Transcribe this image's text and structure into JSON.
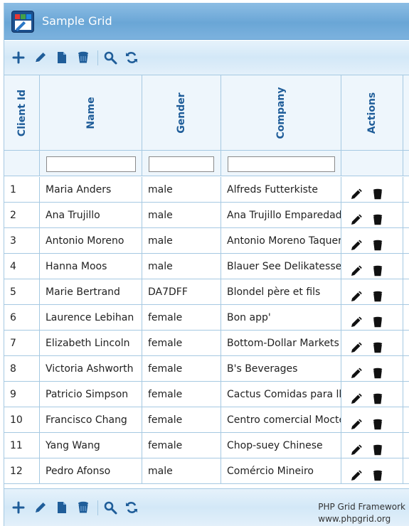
{
  "app": {
    "title": "Sample Grid"
  },
  "toolbar": {
    "buttons": [
      {
        "icon": "plus-icon",
        "label": "add"
      },
      {
        "icon": "pencil-icon",
        "label": "edit"
      },
      {
        "icon": "document-icon",
        "label": "view"
      },
      {
        "icon": "trash-icon",
        "label": "delete"
      },
      {
        "icon": "search-icon",
        "label": "search"
      },
      {
        "icon": "refresh-icon",
        "label": "refresh"
      }
    ]
  },
  "columns": [
    "Client Id",
    "Name",
    "Gender",
    "Company",
    "Actions"
  ],
  "filters": {
    "name": "",
    "gender": "",
    "company": ""
  },
  "rows": [
    {
      "id": "1",
      "name": "Maria Anders",
      "gender": "male",
      "company": "Alfreds Futterkiste"
    },
    {
      "id": "2",
      "name": "Ana Trujillo",
      "gender": "male",
      "company": "Ana Trujillo Emparedados"
    },
    {
      "id": "3",
      "name": "Antonio Moreno",
      "gender": "male",
      "company": "Antonio Moreno Taquería"
    },
    {
      "id": "4",
      "name": "Hanna Moos",
      "gender": "male",
      "company": "Blauer See Delikatessen"
    },
    {
      "id": "5",
      "name": "Marie Bertrand",
      "gender": "DA7DFF",
      "company": "Blondel père et fils"
    },
    {
      "id": "6",
      "name": "Laurence Lebihan",
      "gender": "female",
      "company": "Bon app'"
    },
    {
      "id": "7",
      "name": "Elizabeth Lincoln",
      "gender": "female",
      "company": "Bottom-Dollar Markets"
    },
    {
      "id": "8",
      "name": "Victoria Ashworth",
      "gender": "female",
      "company": "B's Beverages"
    },
    {
      "id": "9",
      "name": "Patricio Simpson",
      "gender": "female",
      "company": "Cactus Comidas para llevar"
    },
    {
      "id": "10",
      "name": "Francisco Chang",
      "gender": "female",
      "company": "Centro comercial Moctezuma"
    },
    {
      "id": "11",
      "name": "Yang Wang",
      "gender": "female",
      "company": "Chop-suey Chinese"
    },
    {
      "id": "12",
      "name": "Pedro Afonso",
      "gender": "male",
      "company": "Comércio Mineiro"
    }
  ],
  "footer": {
    "credit_line1": "PHP Grid Framework",
    "credit_line2": "www.phpgrid.org"
  },
  "colors": {
    "accent": "#1f5d99",
    "border": "#a6c9e2",
    "title_bg": "#7cb2de"
  }
}
